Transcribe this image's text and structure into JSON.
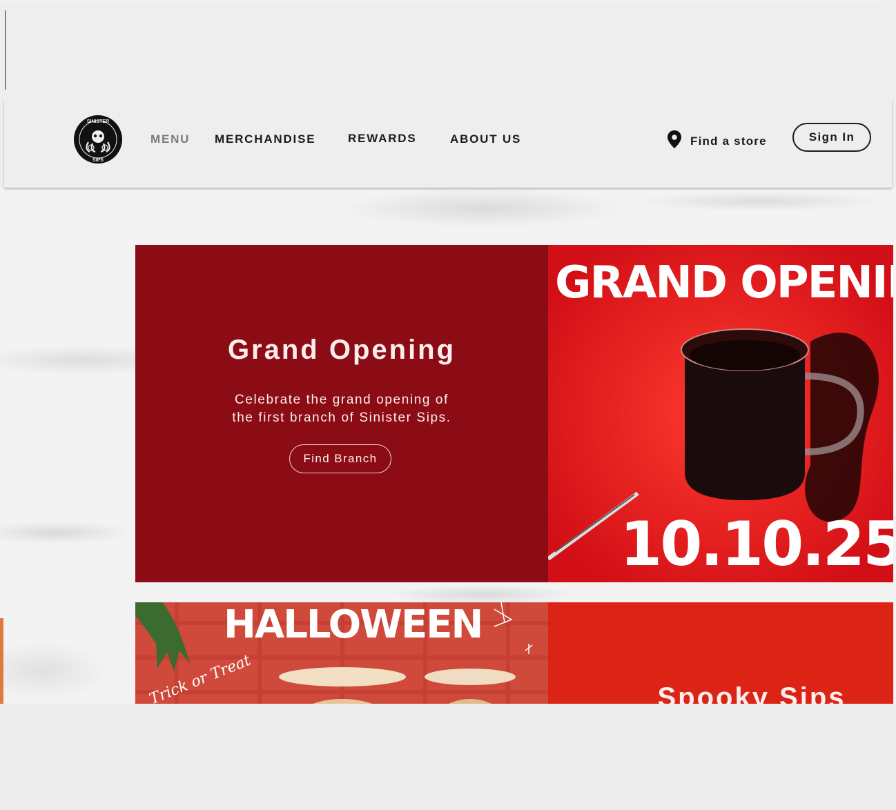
{
  "header": {
    "logo_text_top": "SINISTER",
    "logo_text_bottom": "SIPS",
    "nav": {
      "menu": "MENU",
      "merchandise": "MERCHANDISE",
      "rewards": "REWARDS",
      "about": "ABOUT US"
    },
    "find_store": "Find a store",
    "sign_in": "Sign In"
  },
  "promo_grand_opening": {
    "title": "Grand Opening",
    "description_line1": "Celebrate the grand opening of",
    "description_line2": "the first branch of Sinister Sips.",
    "button": "Find Branch",
    "image_headline": "GRAND OPENIN",
    "image_date": "10.10.25"
  },
  "promo_halloween": {
    "image_headline": "HALLOWEEN",
    "image_script": "Trick or Treat",
    "title": "Spooky Sips"
  },
  "colors": {
    "dark_red": "#8b0c15",
    "bright_red": "#e0141a",
    "halloween_red": "#dc2416"
  }
}
